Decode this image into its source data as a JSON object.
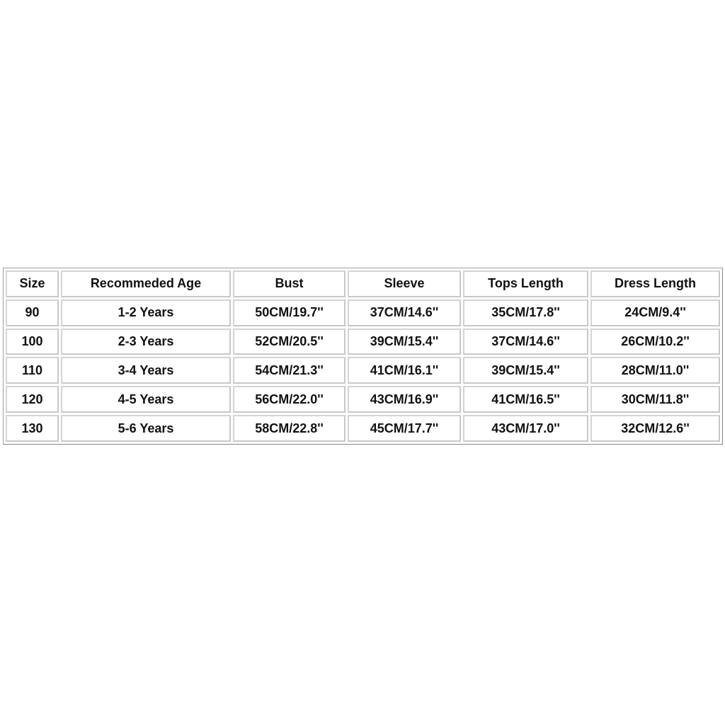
{
  "table": {
    "headers": [
      "Size",
      "Recommeded Age",
      "Bust",
      "Sleeve",
      "Tops Length",
      "Dress Length"
    ],
    "rows": [
      [
        "90",
        "1-2 Years",
        "50CM/19.7''",
        "37CM/14.6''",
        "35CM/17.8''",
        "24CM/9.4''"
      ],
      [
        "100",
        "2-3 Years",
        "52CM/20.5''",
        "39CM/15.4''",
        "37CM/14.6''",
        "26CM/10.2''"
      ],
      [
        "110",
        "3-4 Years",
        "54CM/21.3''",
        "41CM/16.1''",
        "39CM/15.4''",
        "28CM/11.0''"
      ],
      [
        "120",
        "4-5 Years",
        "56CM/22.0''",
        "43CM/16.9''",
        "41CM/16.5''",
        "30CM/11.8''"
      ],
      [
        "130",
        "5-6 Years",
        "58CM/22.8''",
        "45CM/17.7''",
        "43CM/17.0''",
        "32CM/12.6''"
      ]
    ]
  }
}
